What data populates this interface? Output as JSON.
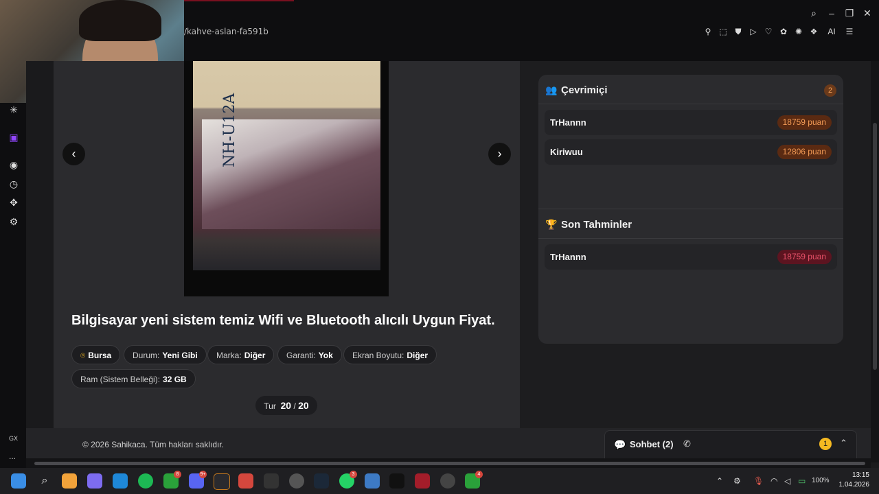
{
  "browser": {
    "url": "/kahve-aslan-fa591b",
    "window_controls": [
      "search-icon",
      "minimize-icon",
      "restore-icon",
      "close-icon"
    ],
    "extensions_ai_label": "AI"
  },
  "listing": {
    "photo_model_text": "NH-U12A",
    "title": "Bilgisayar yeni sistem temiz Wifi ve Bluetooth alıcılı Uygun Fiyat.",
    "location": "Bursa",
    "specs": [
      {
        "label": "Durum:",
        "value": "Yeni Gibi"
      },
      {
        "label": "Marka:",
        "value": "Diğer"
      },
      {
        "label": "Garanti:",
        "value": "Yok"
      },
      {
        "label": "Ekran Boyutu:",
        "value": "Diğer"
      },
      {
        "label": "Ram (Sistem Belleği):",
        "value": "32 GB"
      }
    ],
    "pager": {
      "label": "Tur",
      "current": "20",
      "separator": "/",
      "total": "20"
    }
  },
  "online_panel": {
    "title": "Çevrimiçi",
    "count": "2",
    "users": [
      {
        "name": "TrHannn",
        "points": "18759 puan"
      },
      {
        "name": "Kiriwuu",
        "points": "12806 puan"
      }
    ]
  },
  "predictions_panel": {
    "title": "Son Tahminler",
    "entries": [
      {
        "name": "TrHannn",
        "points": "18759 puan"
      }
    ]
  },
  "footer": {
    "copyright": "© 2026 Sahikaca. Tüm hakları saklıdır."
  },
  "chat": {
    "label": "Sohbet (2)",
    "unread": "1"
  },
  "sidebar": {
    "gx_label": "GX",
    "more_label": "..."
  },
  "taskbar": {
    "badges": {
      "xbox": "8",
      "discord": "9+",
      "whatsapp": "3",
      "xbox2": "4"
    },
    "battery": "100%",
    "time": "13:15",
    "date": "1.04.2026"
  },
  "colors": {
    "accent": "#f5b921",
    "points_orange": "#f29a55",
    "points_red": "#e9526a",
    "panel_bg": "#2b2b2e"
  }
}
